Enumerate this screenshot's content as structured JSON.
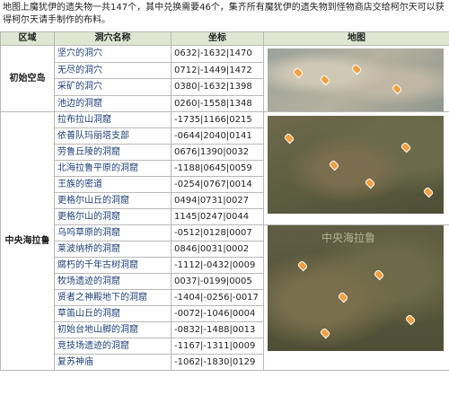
{
  "intro": "地图上魔犹伊的遗失物一共147个，其中兑换需要46个，集齐所有魔犹伊的遗失物到怪物商店交给柯尔天可以获得柯尔天请手制作的布料。",
  "headers": {
    "region": "区域",
    "cave": "洞穴名称",
    "coord": "坐标",
    "map": "地图"
  },
  "regions": {
    "start": "初始空岛",
    "central": "中央海拉鲁"
  },
  "map_label": "中央海拉鲁",
  "colors": {
    "header_bg": "#dfe7d2",
    "grid": "#b8b8b8",
    "link_text": "#1f3f7a"
  },
  "rows_start": [
    {
      "name": "坚穴的洞穴",
      "coord": "0632|-1632|1470"
    },
    {
      "name": "无尽的洞穴",
      "coord": "0712|-1449|1472"
    },
    {
      "name": "采矿的洞穴",
      "coord": "0380|-1632|1398"
    },
    {
      "name": "池边的洞窟",
      "coord": "0260|-1558|1348"
    }
  ],
  "rows_central": [
    {
      "name": "拉布拉山洞窟",
      "coord": "-1735|1166|0215"
    },
    {
      "name": "依善队玛丽塔支部",
      "coord": "-0644|2040|0141"
    },
    {
      "name": "劳鲁丘陵的洞窟",
      "coord": "0676|1390|0032"
    },
    {
      "name": "北海拉鲁平原的洞窟",
      "coord": "-1188|0645|0059"
    },
    {
      "name": "王族的密道",
      "coord": "-0254|0767|0014"
    },
    {
      "name": "更格尔山丘的洞窟",
      "coord": "0494|0731|0027"
    },
    {
      "name": "更格尔山的洞窟",
      "coord": "1145|0247|0044"
    },
    {
      "name": "乌呜草原的洞窟",
      "coord": "-0512|0128|0007"
    },
    {
      "name": "莱波纳桥的洞窟",
      "coord": "0846|0031|0002"
    },
    {
      "name": "腐朽的千年古树洞窟",
      "coord": "-1112|-0432|0009"
    },
    {
      "name": "牧场遗迹的洞窟",
      "coord": "0037|-0199|0005"
    },
    {
      "name": "贤者之神殿地下的洞窟",
      "coord": "-1404|-0256|-0017"
    },
    {
      "name": "草笛山丘的洞窟",
      "coord": "-0072|-1046|0004"
    },
    {
      "name": "初始台地山脚的洞窟",
      "coord": "-0832|-1488|0013"
    },
    {
      "name": "竞技场遗迹的洞窟",
      "coord": "-1167|-1311|0009"
    },
    {
      "name": "复苏神庙",
      "coord": "-1062|-1830|0129"
    }
  ]
}
